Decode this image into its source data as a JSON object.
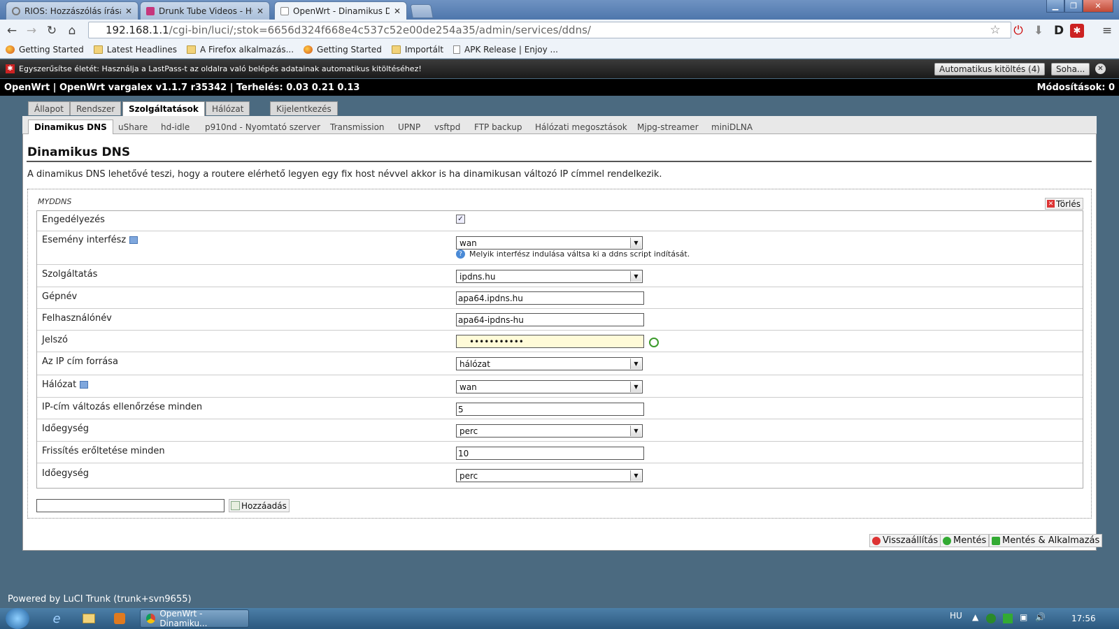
{
  "browser": {
    "tabs": [
      {
        "title": "RIOS: Hozzászólás írása - T",
        "icon_color": "#888888"
      },
      {
        "title": "Drunk Tube Videos - HQ D",
        "icon_color": "#c6367c"
      },
      {
        "title": "OpenWrt - Dinamikus DN",
        "icon_color": "#ffffff"
      }
    ],
    "url_host": "192.168.1.1",
    "url_path": "/cgi-bin/luci/;stok=6656d324f668e4c537c52e00de254a35/admin/services/ddns/",
    "bookmarks": [
      {
        "label": "Getting Started",
        "icon": "firefox-icon"
      },
      {
        "label": "Latest Headlines",
        "icon": "folder-icon"
      },
      {
        "label": "A Firefox alkalmazás...",
        "icon": "folder-icon"
      },
      {
        "label": "Getting Started",
        "icon": "firefox-icon"
      },
      {
        "label": "Importált",
        "icon": "folder-icon"
      },
      {
        "label": "APK Release | Enjoy ...",
        "icon": "page-icon"
      }
    ]
  },
  "lastpass": {
    "message": "Egyszerűsítse életét: Használja a LastPass-t az oldalra való belépés adatainak automatikus kitöltéséhez!",
    "autofill_label": "Automatikus kitöltés (4)",
    "never_label": "Soha..."
  },
  "openwrt": {
    "header_left": "OpenWrt | OpenWrt vargalex v1.1.7 r35342 | Terhelés: 0.03 0.21 0.13",
    "header_right": "Módosítások: 0",
    "main_tabs": [
      "Állapot",
      "Rendszer",
      "Szolgáltatások",
      "Hálózat",
      "Kijelentkezés"
    ],
    "sub_tabs": [
      "Dinamikus DNS",
      "uShare",
      "hd-idle",
      "p910nd - Nyomtató szerver",
      "Transmission",
      "UPNP",
      "vsftpd",
      "FTP backup",
      "Hálózati megosztások",
      "Mjpg-streamer",
      "miniDLNA"
    ],
    "page_title": "Dinamikus DNS",
    "description": "A dinamikus DNS lehetővé teszi, hogy a routere elérhető legyen egy fix host névvel akkor is ha dinamikusan változó IP címmel rendelkezik.",
    "section_name": "MYDDNS",
    "delete_label": "Törlés",
    "fields": {
      "enable": {
        "label": "Engedélyezés",
        "checked": true,
        "check_mark": "✓"
      },
      "event_interface": {
        "label": "Esemény interfész",
        "value": "wan",
        "hint": "Melyik interfész indulása váltsa ki a ddns script indítását."
      },
      "service": {
        "label": "Szolgáltatás",
        "value": "ipdns.hu"
      },
      "hostname": {
        "label": "Gépnév",
        "value": "apa64.ipdns.hu"
      },
      "username": {
        "label": "Felhasználónév",
        "value": "apa64-ipdns-hu"
      },
      "password": {
        "label": "Jelszó",
        "value": "•••••••••••"
      },
      "ip_source": {
        "label": "Az IP cím forrása",
        "value": "hálózat"
      },
      "network": {
        "label": "Hálózat",
        "value": "wan"
      },
      "check_interval": {
        "label": "IP-cím változás ellenőrzése minden",
        "value": "5"
      },
      "check_unit": {
        "label": "Időegység",
        "value": "perc"
      },
      "force_interval": {
        "label": "Frissítés erőltetése minden",
        "value": "10"
      },
      "force_unit": {
        "label": "Időegység",
        "value": "perc"
      }
    },
    "add_label": "Hozzáadás",
    "actions": {
      "reset": "Visszaállítás",
      "save": "Mentés",
      "save_apply": "Mentés & Alkalmazás"
    },
    "footer": "Powered by LuCI Trunk (trunk+svn9655)"
  },
  "taskbar": {
    "active_window": "OpenWrt - Dinamiku...",
    "lang": "HU",
    "clock": "17:56"
  }
}
